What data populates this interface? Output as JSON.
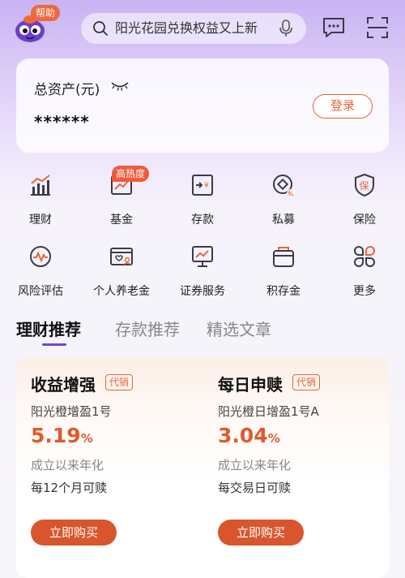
{
  "header": {
    "help_badge": "帮助",
    "search_text": "阳光花园兑换权益又上新"
  },
  "asset": {
    "title": "总资产(元)",
    "value": "******",
    "login_label": "登录"
  },
  "menu": {
    "hot_badge": "高热度",
    "items": [
      {
        "label": "理财",
        "icon": "chart-bars-icon"
      },
      {
        "label": "基金",
        "icon": "fund-chart-icon"
      },
      {
        "label": "存款",
        "icon": "deposit-icon"
      },
      {
        "label": "私募",
        "icon": "private-fund-icon"
      },
      {
        "label": "保险",
        "icon": "insurance-shield-icon"
      },
      {
        "label": "风险评估",
        "icon": "risk-pulse-icon"
      },
      {
        "label": "个人养老金",
        "icon": "pension-card-icon"
      },
      {
        "label": "证券服务",
        "icon": "securities-monitor-icon"
      },
      {
        "label": "积存金",
        "icon": "gold-bag-icon"
      },
      {
        "label": "更多",
        "icon": "more-grid-icon"
      }
    ]
  },
  "tabs": [
    {
      "label": "理财推荐",
      "active": true
    },
    {
      "label": "存款推荐",
      "active": false
    },
    {
      "label": "精选文章",
      "active": false
    }
  ],
  "products": [
    {
      "title": "收益增强",
      "tag": "代销",
      "name": "阳光橙增盈1号",
      "rate": "5.19",
      "rate_unit": "%",
      "rate_desc": "成立以来年化",
      "term": "每12个月可赎",
      "buy_label": "立即购买"
    },
    {
      "title": "每日申赎",
      "tag": "代销",
      "name": "阳光橙日增盈1号A",
      "rate": "3.04",
      "rate_unit": "%",
      "rate_desc": "成立以来年化",
      "term": "每交易日可赎",
      "buy_label": "立即购买"
    }
  ],
  "colors": {
    "accent_orange": "#e2673c",
    "button_orange": "#d9552d",
    "tab_underline": "#6a4ad6",
    "icon_dark": "#3a3a4a"
  }
}
